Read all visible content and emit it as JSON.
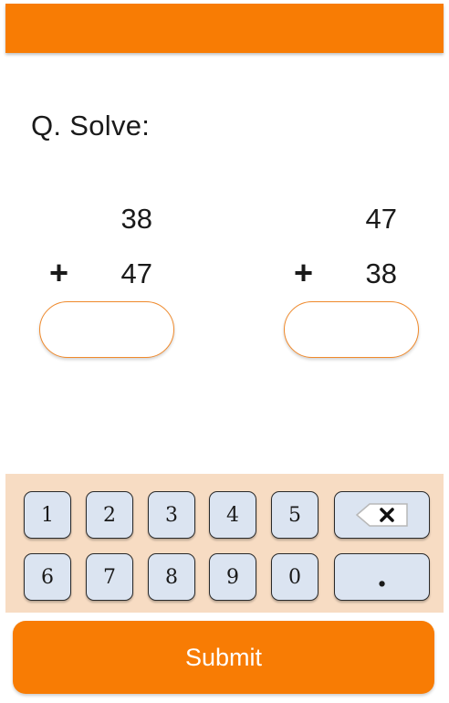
{
  "header": {
    "color": "#f87c04"
  },
  "question": {
    "title": "Q. Solve:"
  },
  "problems": [
    {
      "top": "38",
      "operator": "+",
      "bottom": "47",
      "answer": ""
    },
    {
      "top": "47",
      "operator": "+",
      "bottom": "38",
      "answer": ""
    }
  ],
  "keypad": {
    "row1": [
      "1",
      "2",
      "3",
      "4",
      "5"
    ],
    "row2": [
      "6",
      "7",
      "8",
      "9",
      "0"
    ],
    "backspace_icon": "backspace-icon",
    "decimal_label": "."
  },
  "submit": {
    "label": "Submit"
  },
  "colors": {
    "accent": "#f87c04",
    "keypad_bg": "#f7dcc3",
    "key_bg": "#dbe4f1"
  }
}
